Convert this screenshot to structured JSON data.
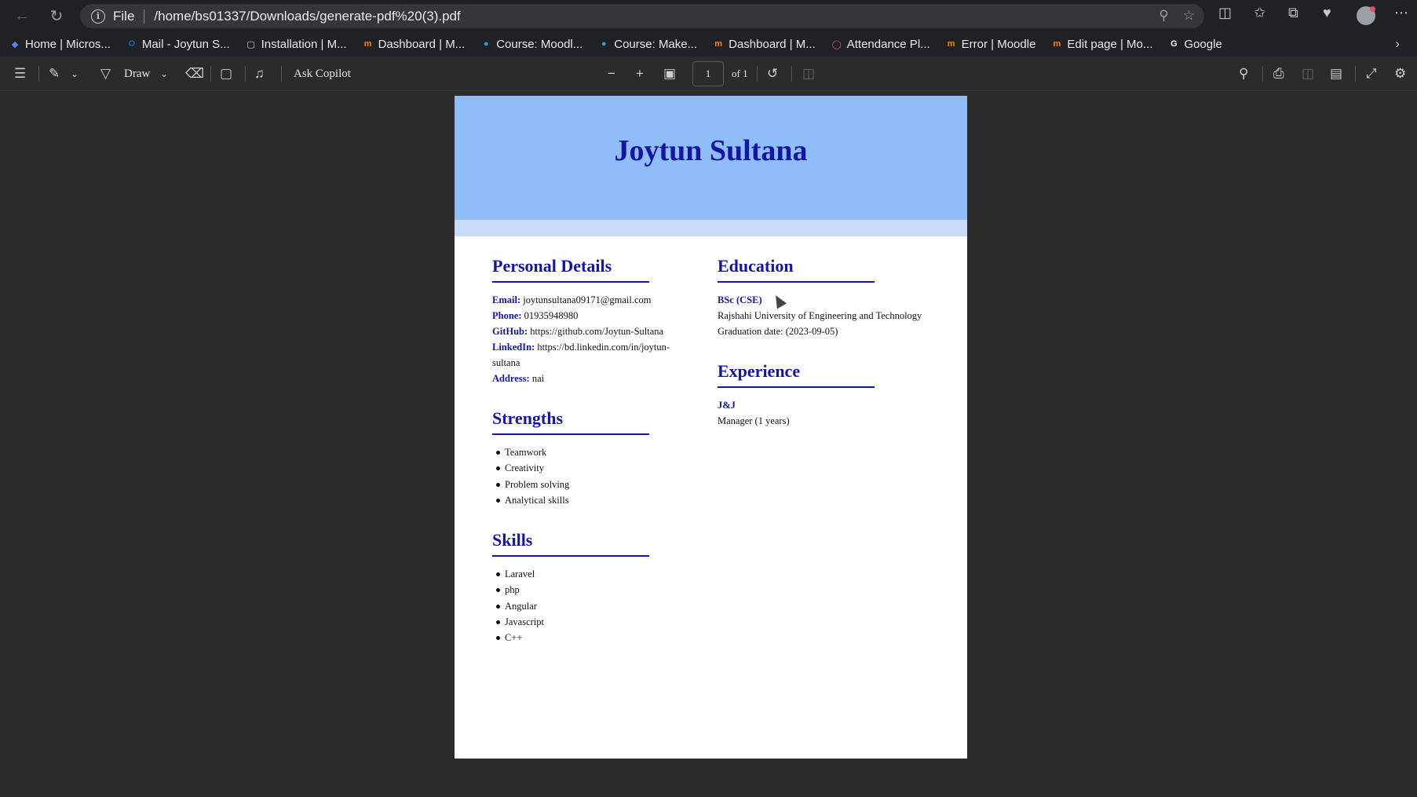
{
  "browser": {
    "scheme_label": "File",
    "url": "/home/bs01337/Downloads/generate-pdf%20(3).pdf"
  },
  "bookmarks": [
    {
      "label": "Home | Micros...",
      "icon": "copilot-icon",
      "color": "#6b7cff"
    },
    {
      "label": "Mail - Joytun S...",
      "icon": "outlook-icon",
      "color": "#0f6cbd"
    },
    {
      "label": "Installation | M...",
      "icon": "page-icon",
      "color": "#cccccc"
    },
    {
      "label": "Dashboard | M...",
      "icon": "moodle-icon",
      "color": "#f98012"
    },
    {
      "label": "Course: Moodl...",
      "icon": "moodle-dot-icon",
      "color": "#2b9de2"
    },
    {
      "label": "Course: Make...",
      "icon": "moodle-dot-icon",
      "color": "#2b9de2"
    },
    {
      "label": "Dashboard | M...",
      "icon": "moodle-icon",
      "color": "#f98012"
    },
    {
      "label": "Attendance Pl...",
      "icon": "circle-icon",
      "color": "#c64a8a"
    },
    {
      "label": "Error | Moodle",
      "icon": "moodle-icon",
      "color": "#f98012"
    },
    {
      "label": "Edit page | Mo...",
      "icon": "moodle-icon",
      "color": "#f98012"
    },
    {
      "label": "Google",
      "icon": "google-icon",
      "color": "#ffffff"
    }
  ],
  "pdf_toolbar": {
    "draw_label": "Draw",
    "copilot_label": "Ask Copilot",
    "page_number": "1",
    "page_total": "of 1"
  },
  "resume": {
    "name": "Joytun Sultana",
    "personal": {
      "title": "Personal Details",
      "email_label": "Email:",
      "email": "joytunsultana09171@gmail.com",
      "phone_label": "Phone:",
      "phone": "01935948980",
      "github_label": "GitHub:",
      "github": "https://github.com/Joytun-Sultana",
      "linkedin_label": "LinkedIn:",
      "linkedin": "https://bd.linkedin.com/in/joytun-sultana",
      "address_label": "Address:",
      "address": "nai"
    },
    "strengths": {
      "title": "Strengths",
      "items": [
        "Teamwork",
        "Creativity",
        "Problem solving",
        "Analytical skills"
      ]
    },
    "skills": {
      "title": "Skills",
      "items": [
        "Laravel",
        "php",
        "Angular",
        "Javascript",
        "C++"
      ]
    },
    "education": {
      "title": "Education",
      "degree": "BSc (CSE)",
      "institution": "Rajshahi University of Engineering and Technology",
      "graduation": "Graduation date: (2023-09-05)"
    },
    "experience": {
      "title": "Experience",
      "company": "J&J",
      "role": "Manager (1 years)"
    }
  }
}
